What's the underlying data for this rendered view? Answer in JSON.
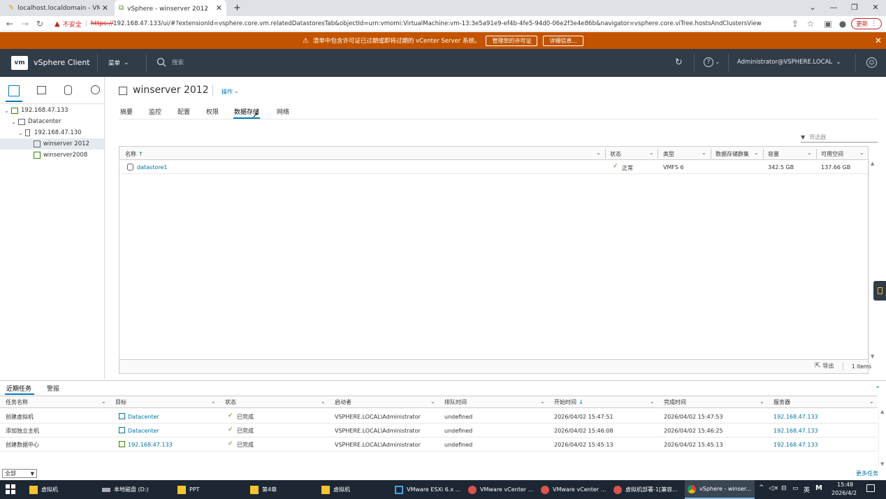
{
  "browser": {
    "tabs": [
      {
        "title": "localhost.localdomain - VMwa"
      },
      {
        "title": "vSphere - winserver 2012 - 数据"
      }
    ],
    "address": {
      "security_label": "不安全",
      "url_scheme": "https://",
      "url_rest": "192.168.47.133/ui/#?extensionId=vsphere.core.vm.relatedDatastoresTab&objectId=urn:vmomi:VirtualMachine:vm-13:3e5a91e9-ef4b-4fe5-94d0-06e2f3e4e86b&navigator=vsphere.core.viTree.hostsAndClustersView"
    },
    "update_label": "更新"
  },
  "banner": {
    "message": "清单中包含许可证已过期或即将过期的 vCenter Server 系统。",
    "btn_manage": "管理您的许可证",
    "btn_details": "详细信息..."
  },
  "header": {
    "logo": "vm",
    "app_title": "vSphere Client",
    "menu_label": "菜单",
    "search_placeholder": "搜索",
    "user": "Administrator@VSPHERE.LOCAL"
  },
  "tree": [
    {
      "label": "192.168.47.133"
    },
    {
      "label": "Datacenter"
    },
    {
      "label": "192.168.47.130"
    },
    {
      "label": "winserver 2012"
    },
    {
      "label": "winserver2008"
    }
  ],
  "object": {
    "title": "winserver 2012",
    "actions_label": "操作",
    "tabs": [
      "摘要",
      "监控",
      "配置",
      "权限",
      "数据存储",
      "网络"
    ]
  },
  "datastores": {
    "filter_placeholder": "筛选器",
    "columns": [
      "名称",
      "状态",
      "类型",
      "数据存储群集",
      "容量",
      "可用空间"
    ],
    "rows": [
      {
        "name": "datastore1",
        "status": "正常",
        "type": "VMFS 6",
        "cluster": "",
        "capacity": "342.5 GB",
        "free": "137.66 GB"
      }
    ],
    "export_label": "导出",
    "count_label": "1 items"
  },
  "tasks": {
    "tabs": [
      "近期任务",
      "警报"
    ],
    "columns": [
      "任务名称",
      "目标",
      "状态",
      "启动者",
      "排队时间",
      "开始时间",
      "完成时间",
      "服务器"
    ],
    "rows": [
      {
        "name": "创建虚拟机",
        "target": "Datacenter",
        "status": "已完成",
        "initiator": "VSPHERE.LOCAL\\Administrator",
        "queued": "undefined",
        "start": "2026/04/02 15:47:51",
        "end": "2026/04/02 15:47:53",
        "server": "192.168.47.133"
      },
      {
        "name": "添加独立主机",
        "target": "Datacenter",
        "status": "已完成",
        "initiator": "VSPHERE.LOCAL\\Administrator",
        "queued": "undefined",
        "start": "2026/04/02 15:46:08",
        "end": "2026/04/02 15:46:25",
        "server": "192.168.47.133"
      },
      {
        "name": "创建数据中心",
        "target": "192.168.47.133",
        "status": "已完成",
        "initiator": "VSPHERE.LOCAL\\Administrator",
        "queued": "undefined",
        "start": "2026/04/02 15:45:13",
        "end": "2026/04/02 15:45:13",
        "server": "192.168.47.133"
      }
    ],
    "filter_value": "全部",
    "more_tasks": "更多任务"
  },
  "taskbar": {
    "items": [
      "虚拟机",
      "本地磁盘 (D:)",
      "PPT",
      "第4章",
      "虚拟机",
      "VMware ESXi 6.x ...",
      "VMware vCenter ...",
      "VMware vCenter ...",
      "虚拟机部署-1[兼容...",
      "vSphere - winser..."
    ],
    "tray_lang": "英",
    "time": "15:48",
    "date": "2026/4/2"
  },
  "colors": {
    "banner": "#c25400",
    "header": "#303c47",
    "link": "#0072a3",
    "ok": "#318700",
    "taskbar": "#1c2733"
  }
}
